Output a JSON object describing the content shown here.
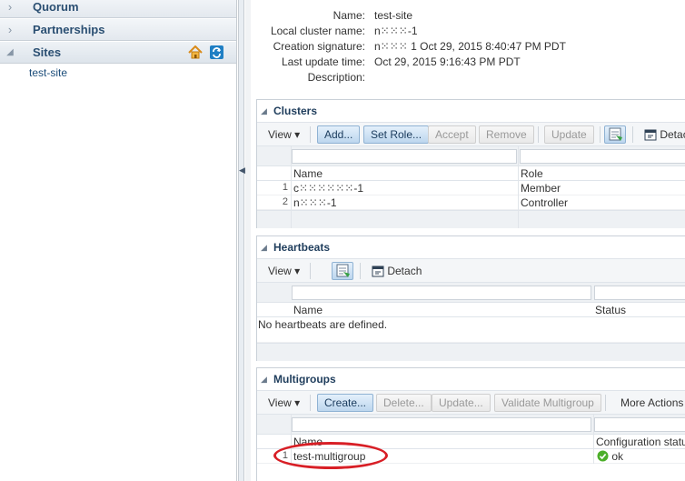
{
  "left_nav": {
    "accordion": [
      {
        "label": "Quorum",
        "state": "collapsed"
      },
      {
        "label": "Partnerships",
        "state": "collapsed"
      },
      {
        "label": "Sites",
        "state": "expanded"
      }
    ],
    "sites_tools": {
      "home_icon": "home-icon",
      "refresh_icon": "refresh-icon"
    },
    "tree_item": "test-site"
  },
  "properties": [
    {
      "label": "Name:",
      "value": "test-site"
    },
    {
      "label": "Local cluster name:",
      "value": "n⁙⁙⁙-1"
    },
    {
      "label": "Creation signature:",
      "value": "n⁙⁙⁙ 1 Oct 29, 2015 8:40:47 PM PDT"
    },
    {
      "label": "Last update time:",
      "value": "Oct 29, 2015 9:16:43 PM PDT"
    },
    {
      "label": "Description:",
      "value": ""
    }
  ],
  "clusters": {
    "title": "Clusters",
    "toolbar": {
      "view": "View",
      "add": "Add...",
      "set_role": "Set Role...",
      "accept": "Accept",
      "remove": "Remove",
      "update": "Update",
      "detach": "Detach"
    },
    "columns": [
      "Name",
      "Role"
    ],
    "rows": [
      {
        "num": "1",
        "name": "c⁙⁙⁙⁙⁙⁙-1",
        "role": "Member"
      },
      {
        "num": "2",
        "name": "n⁙⁙⁙-1",
        "role": "Controller"
      }
    ]
  },
  "heartbeats": {
    "title": "Heartbeats",
    "toolbar": {
      "view": "View",
      "detach": "Detach"
    },
    "columns": [
      "Name",
      "Status"
    ],
    "empty_text": "No heartbeats are defined."
  },
  "multigroups": {
    "title": "Multigroups",
    "toolbar": {
      "view": "View",
      "create": "Create...",
      "delete": "Delete...",
      "update": "Update...",
      "validate": "Validate Multigroup",
      "more_actions": "More Actions"
    },
    "columns": [
      "Name",
      "Configuration status"
    ],
    "rows": [
      {
        "num": "1",
        "name": "test-multigroup",
        "status": "ok"
      }
    ]
  },
  "colors": {
    "accent": "#2b4f72",
    "highlight_circle": "#d81f26",
    "ok": "#4caf2a"
  }
}
